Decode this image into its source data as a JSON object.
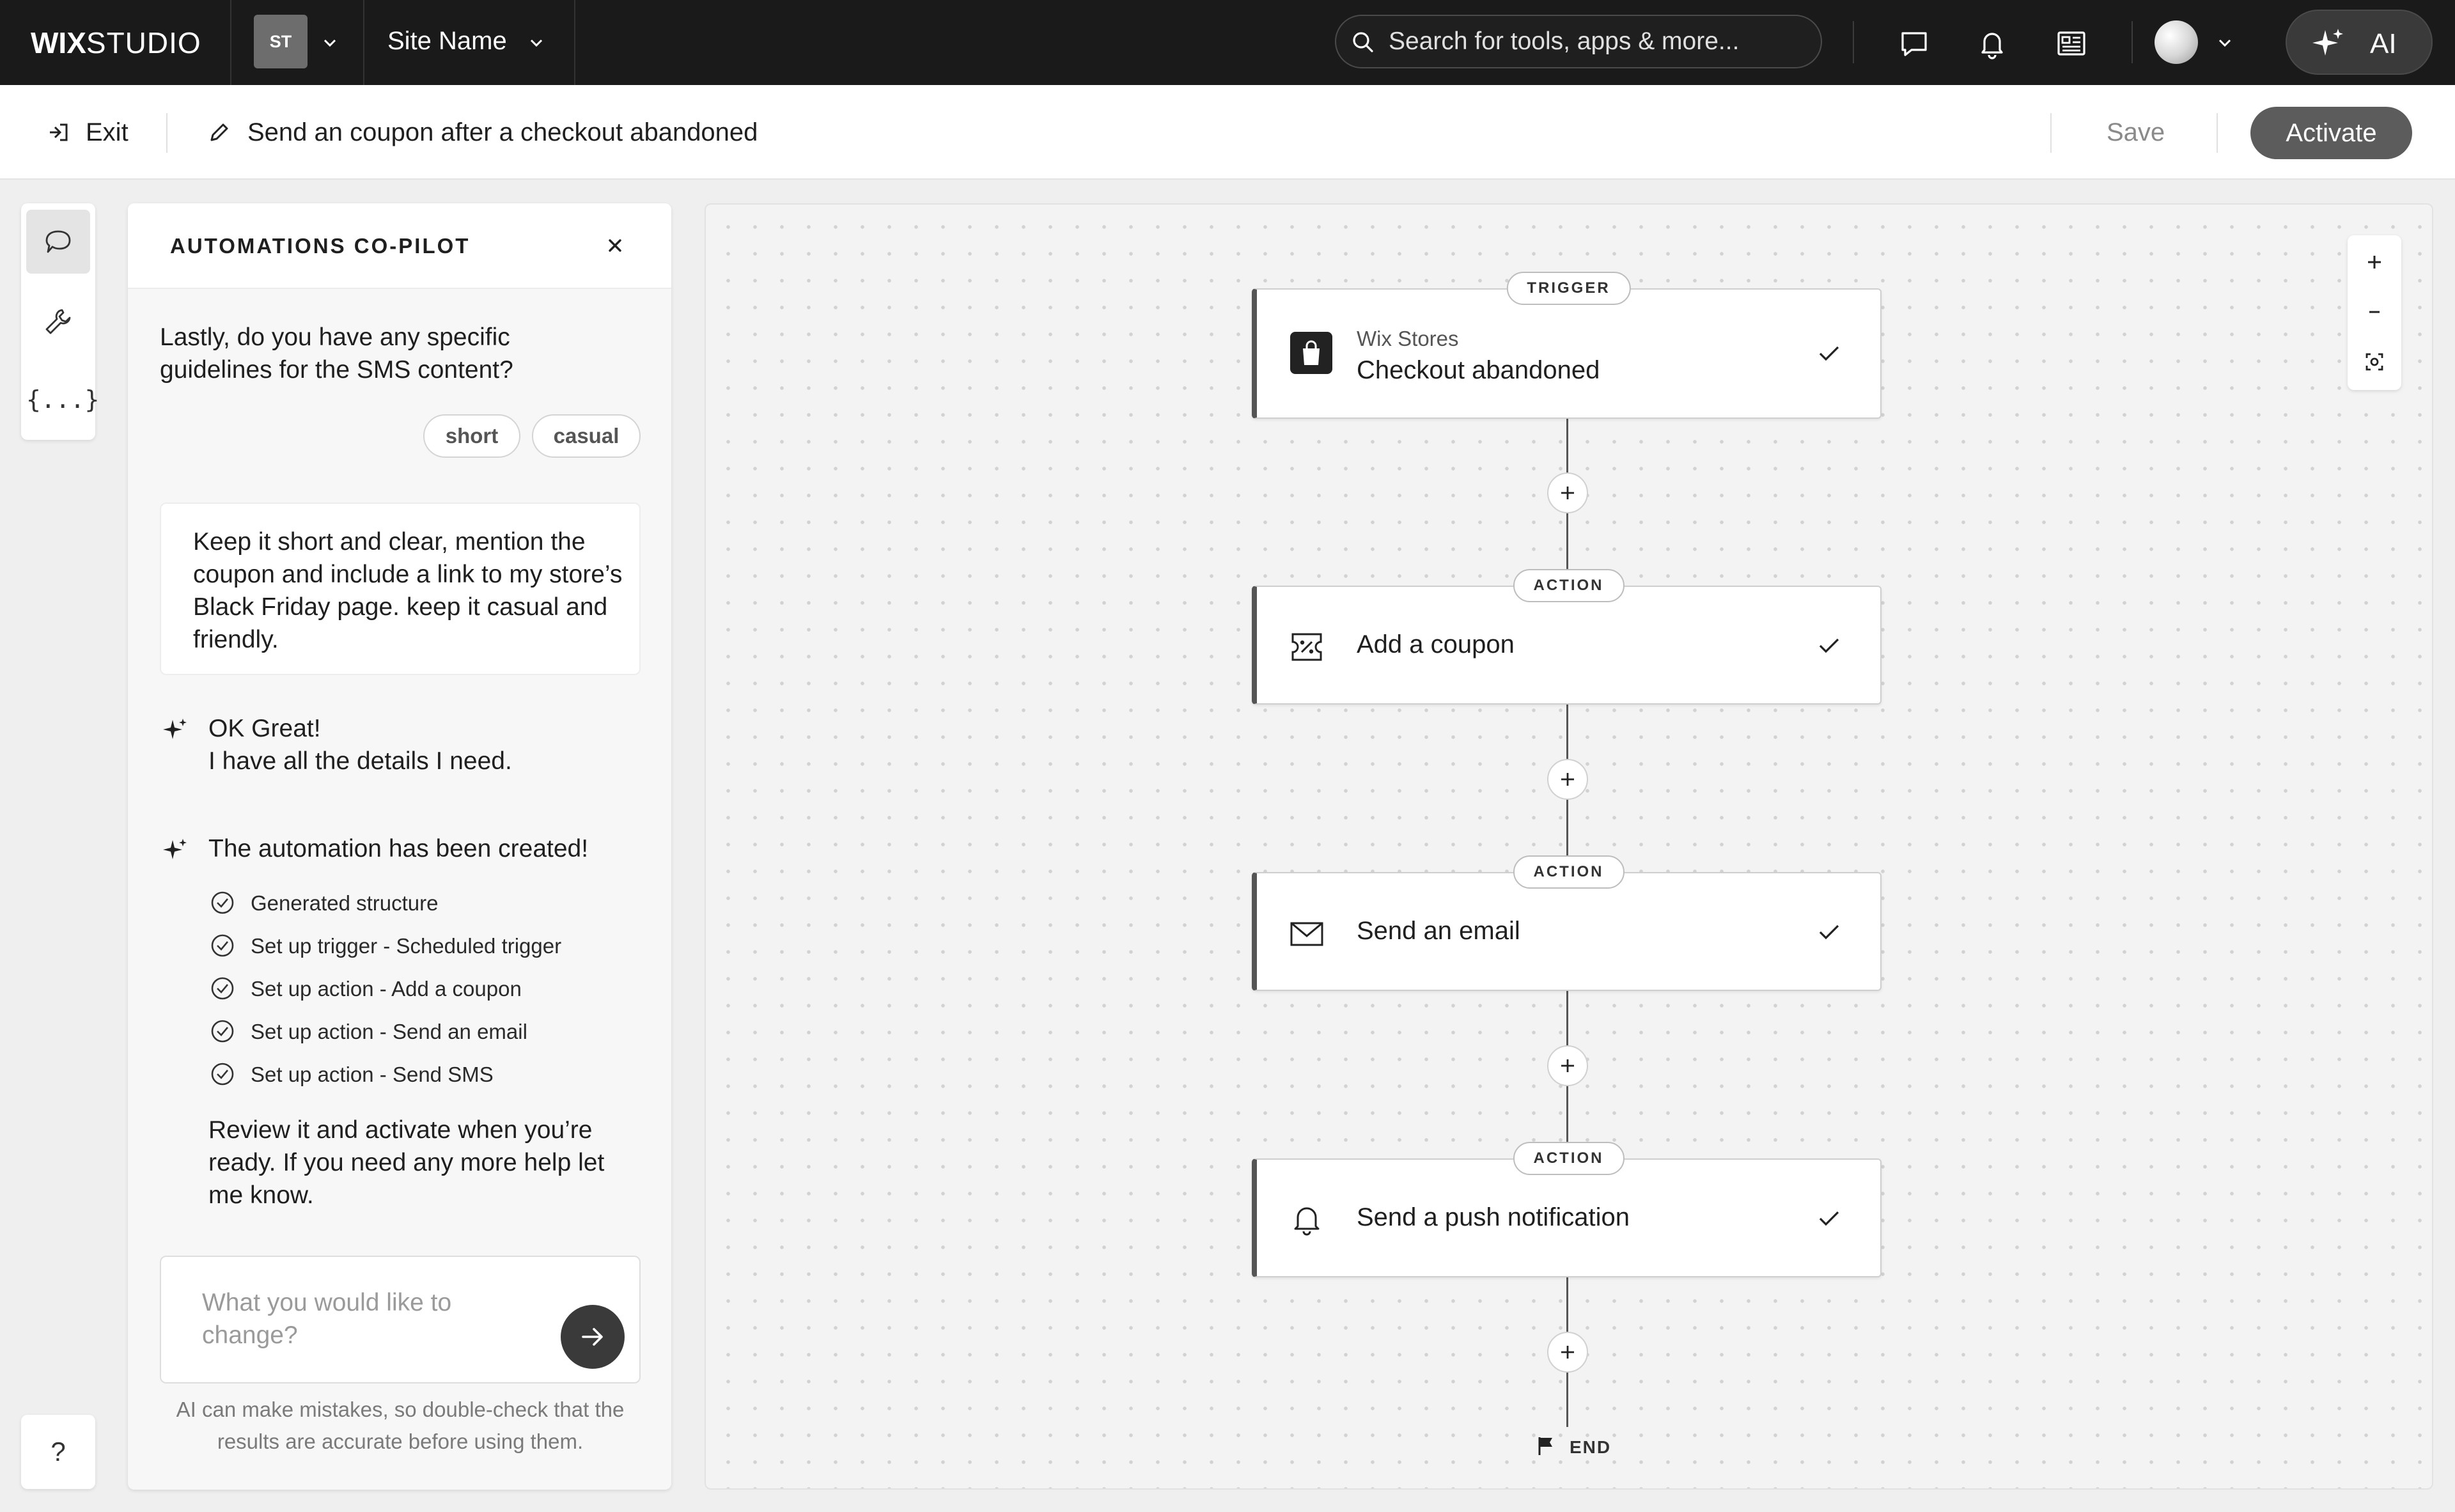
{
  "header": {
    "logo_bold": "WIX",
    "logo_light": "STUDIO",
    "site_initials": "ST",
    "site_name": "Site Name",
    "search_placeholder": "Search for tools, apps & more...",
    "ai_label": "AI"
  },
  "subbar": {
    "exit_label": "Exit",
    "automation_title": "Send an coupon after a checkout abandoned",
    "save_label": "Save",
    "activate_label": "Activate"
  },
  "tools": {
    "help_label": "?",
    "variables_label": "{...}"
  },
  "copilot": {
    "title": "AUTOMATIONS CO-PILOT",
    "question_line1": "Lastly, do you have any specific",
    "question_line2": "guidelines for the SMS content?",
    "chips": [
      "short",
      "casual"
    ],
    "user_message": "Keep it short and clear, mention the coupon and include a link to my store’s Black Friday page. keep it casual and friendly.",
    "ai_reply_line1": "OK Great!",
    "ai_reply_line2": "I have all the details I need.",
    "created_title": "The automation has been created!",
    "steps": [
      "Generated structure",
      "Set up trigger - Scheduled trigger",
      "Set up action - Add a coupon",
      "Set up action - Send an email",
      "Set up action - Send SMS"
    ],
    "review_text": "Review it and activate when you’re ready. If you need any more help let me know.",
    "input_placeholder": "What you would like to change?",
    "disclaimer": "AI can make mistakes, so double-check that the results are accurate before using them."
  },
  "flow": {
    "trigger": {
      "tag": "TRIGGER",
      "app": "Wix Stores",
      "title": "Checkout abandoned",
      "icon": "shopping-bag-icon"
    },
    "actions": [
      {
        "tag": "ACTION",
        "title": "Add a coupon",
        "icon": "coupon-icon"
      },
      {
        "tag": "ACTION",
        "title": "Send an email",
        "icon": "envelope-icon"
      },
      {
        "tag": "ACTION",
        "title": "Send a push notification",
        "icon": "bell-icon"
      }
    ],
    "end_label": "END"
  },
  "colors": {
    "topbar": "#1a1a1a",
    "accent_button": "#5c5c5c",
    "canvas_bg": "#f3f3f3"
  }
}
